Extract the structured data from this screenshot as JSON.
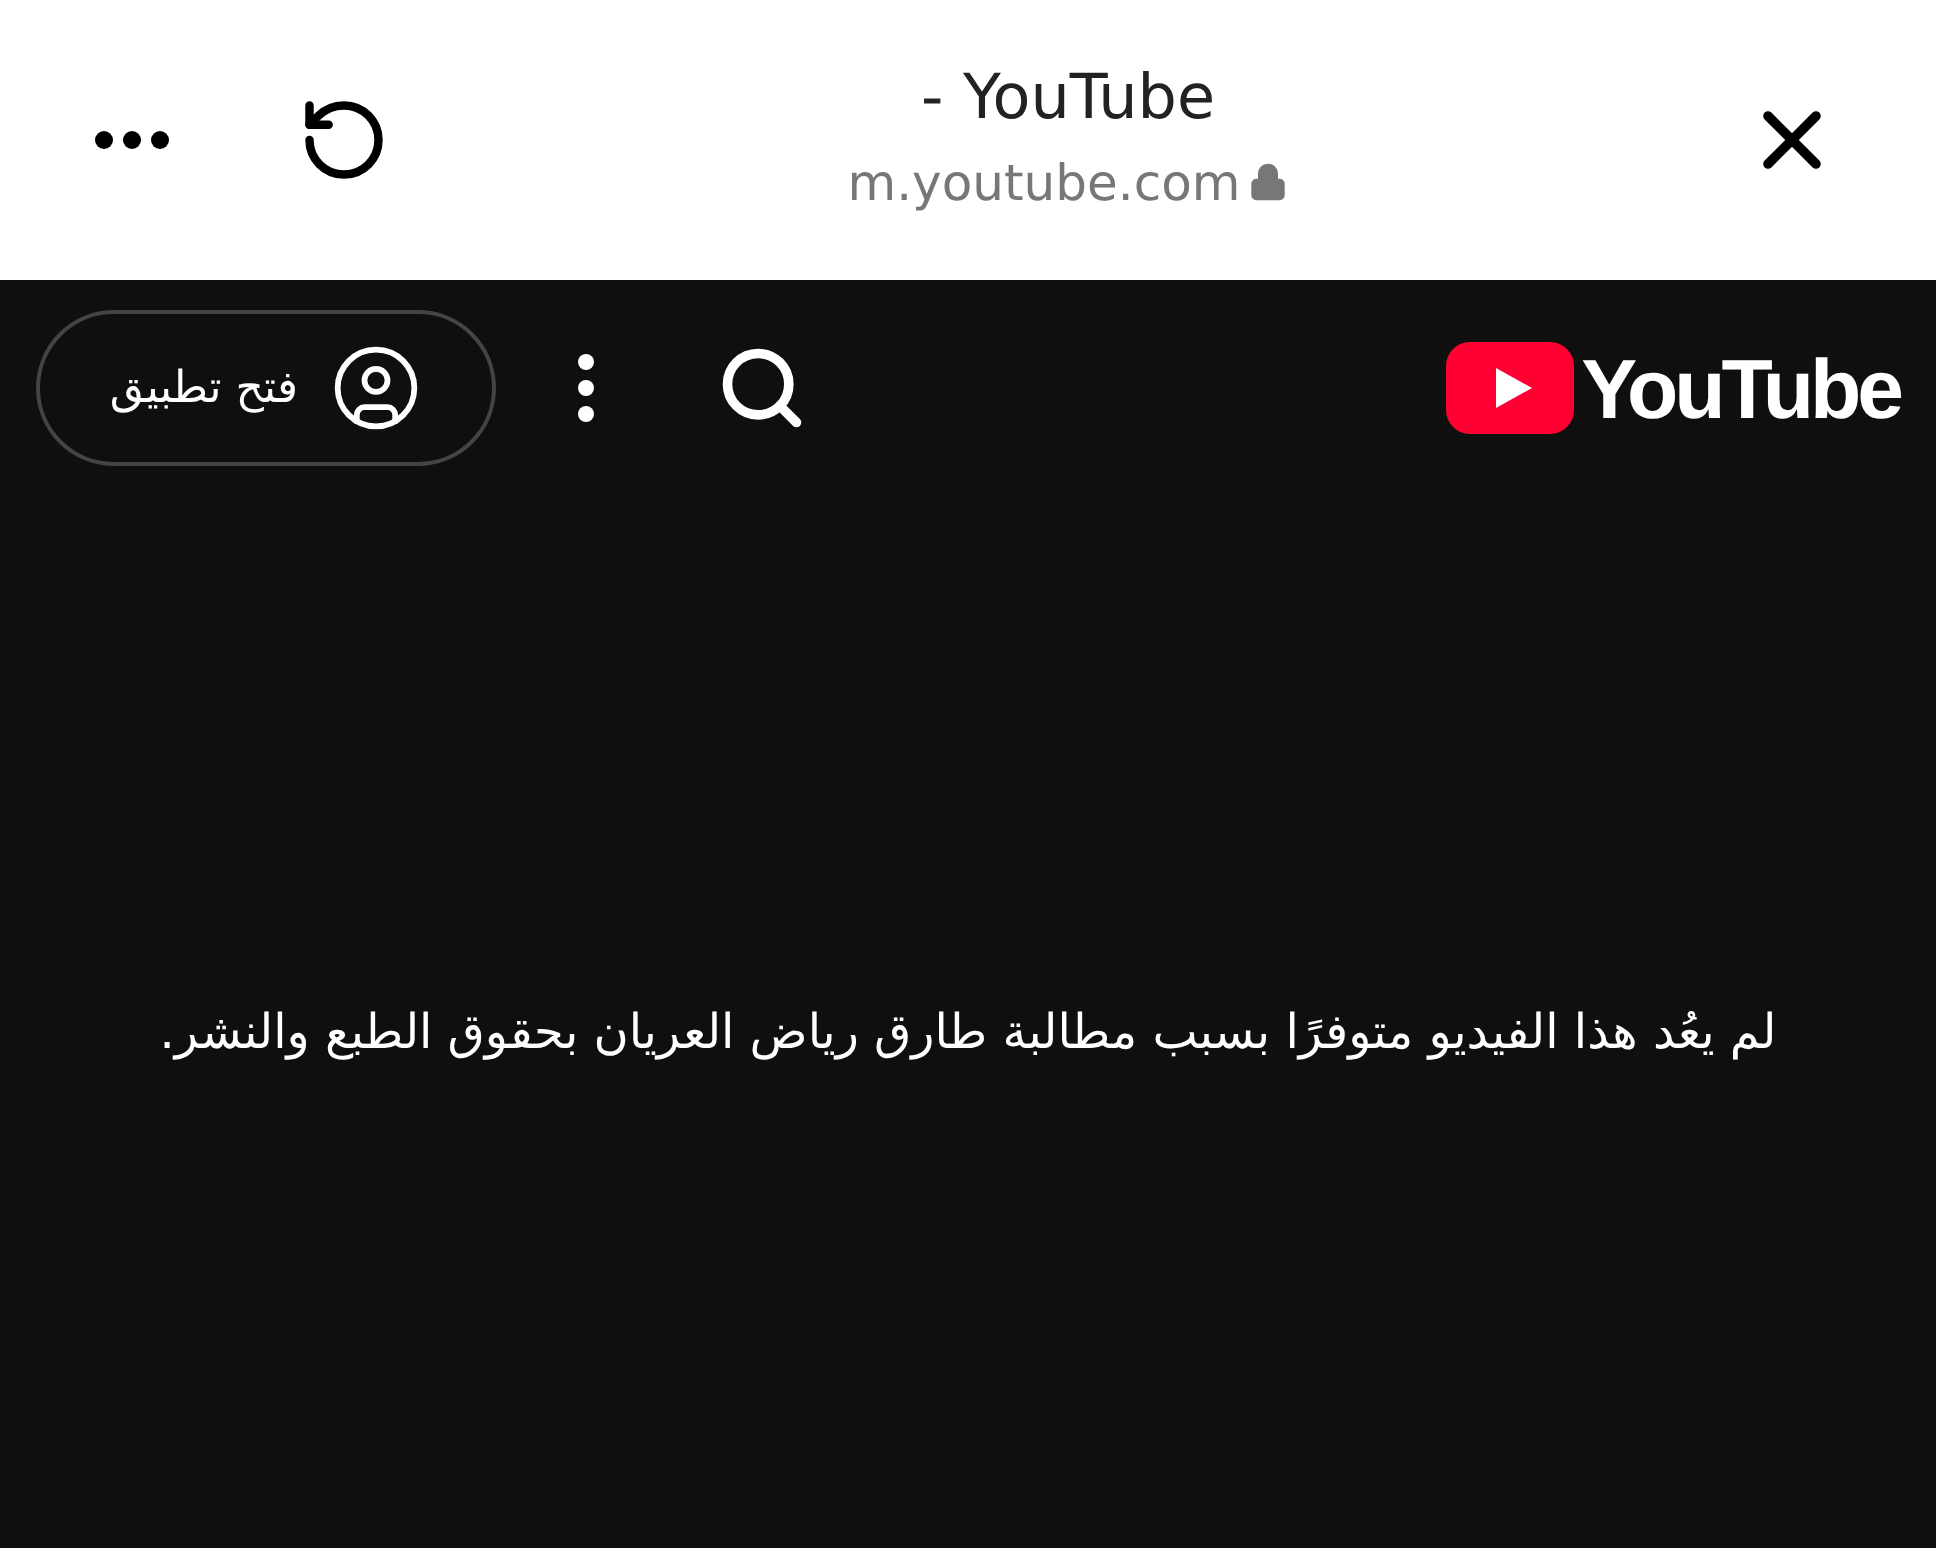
{
  "browser_bar": {
    "title": "- YouTube",
    "url": "m.youtube.com"
  },
  "header": {
    "logo": "YouTube",
    "open_app_button": "فتح تطبيق"
  },
  "message": "لم يعُد هذا الفيديو متوفرًا بسبب مطالبة طارق رياض العريان بحقوق الطبع والنشر."
}
